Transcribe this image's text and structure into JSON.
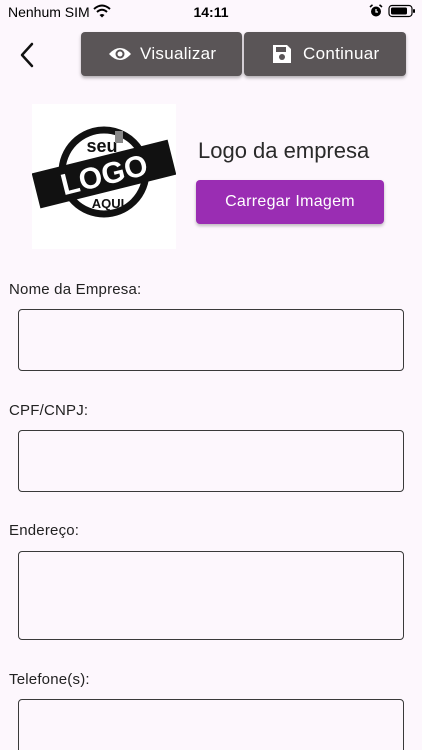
{
  "status_bar": {
    "carrier": "Nenhum SIM",
    "time": "14:11"
  },
  "toolbar": {
    "view_label": "Visualizar",
    "continue_label": "Continuar"
  },
  "logo": {
    "badge_top": "seu",
    "badge_main": "LOGO",
    "badge_bottom": "AQUI",
    "title": "Logo da empresa",
    "upload_label": "Carregar Imagem"
  },
  "fields": {
    "company_name": {
      "label": "Nome da Empresa:",
      "value": ""
    },
    "cpf_cnpj": {
      "label": "CPF/CNPJ:",
      "value": ""
    },
    "address": {
      "label": "Endereço:",
      "value": ""
    },
    "phone": {
      "label": "Telefone(s):",
      "value": ""
    }
  },
  "colors": {
    "background": "#fdf7fd",
    "toolbar_button": "#5a5557",
    "accent": "#9a2db3"
  }
}
